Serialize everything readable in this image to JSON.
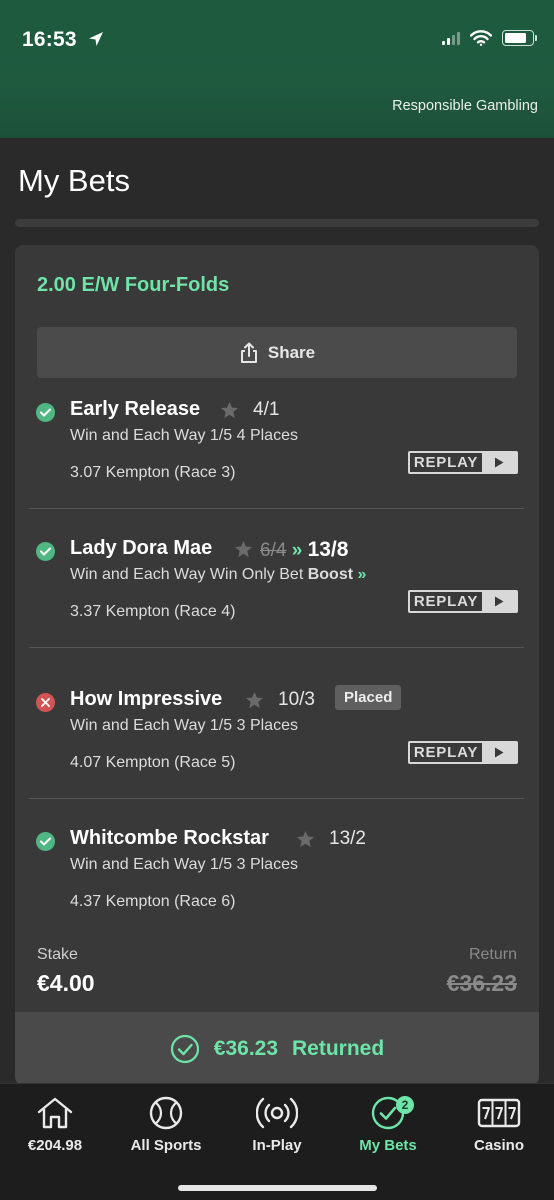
{
  "status_bar": {
    "time": "16:53"
  },
  "header": {
    "responsible_gambling": "Responsible Gambling",
    "title": "My Bets"
  },
  "bet": {
    "type": "2.00 E/W Four-Folds",
    "share_label": "Share",
    "replay_label": "REPLAY",
    "selections": [
      {
        "name": "Early Release",
        "odds": "4/1",
        "market": "Win and Each Way 1/5 4 Places",
        "event": "3.07 Kempton (Race 3)",
        "result": "win"
      },
      {
        "name": "Lady Dora Mae",
        "was_odds": "6/4",
        "boost_arrows": "»",
        "odds": "13/8",
        "market": "Win and Each Way Win Only Bet",
        "boost_label": "Boost",
        "event": "3.37 Kempton (Race 4)",
        "result": "win"
      },
      {
        "name": "How Impressive",
        "odds": "10/3",
        "badge": "Placed",
        "market": "Win and Each Way 1/5 3 Places",
        "event": "4.07 Kempton (Race 5)",
        "result": "lose"
      },
      {
        "name": "Whitcombe Rockstar",
        "odds": "13/2",
        "market": "Win and Each Way 1/5 3 Places",
        "event": "4.37 Kempton (Race 6)",
        "result": "win"
      }
    ],
    "stake_label": "Stake",
    "stake": "€4.00",
    "return_label": "Return",
    "return": "€36.23",
    "returned_amount": "€36.23",
    "returned_label": "Returned"
  },
  "nav": {
    "items": [
      {
        "label": "€204.98",
        "icon": "home-icon"
      },
      {
        "label": "All Sports",
        "icon": "tennis-ball-icon"
      },
      {
        "label": "In-Play",
        "icon": "live-broadcast-icon"
      },
      {
        "label": "My Bets",
        "icon": "check-circle-icon",
        "badge": "2",
        "active": true
      },
      {
        "label": "Casino",
        "icon": "slot-machine-icon"
      }
    ]
  },
  "colors": {
    "accent": "#6ee4a8",
    "header": "#1f5a3f",
    "win": "#4fb782",
    "lose": "#d25555"
  }
}
